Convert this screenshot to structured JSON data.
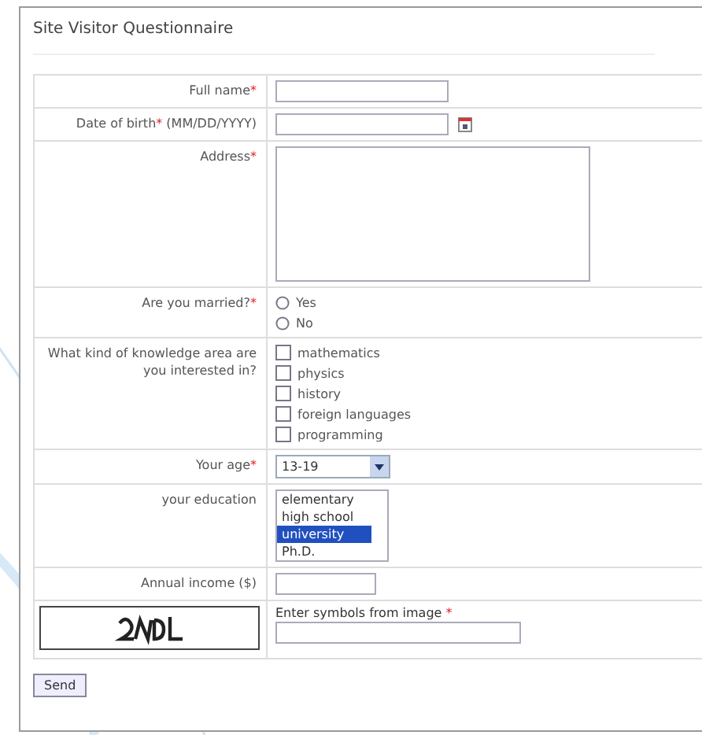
{
  "title": "Site Visitor Questionnaire",
  "fields": [
    {
      "kind": "text",
      "label": "Full name",
      "mark": "*"
    },
    {
      "kind": "date",
      "label": "Date of birth",
      "mark": "*",
      "hint": "(MM/DD/YYYY)"
    },
    {
      "kind": "textarea",
      "label": "Address",
      "mark": "*"
    },
    {
      "kind": "radio",
      "label": "Are you married?",
      "mark": "*",
      "options": [
        {
          "label": "Yes",
          "selected": false
        },
        {
          "label": "No",
          "selected": false
        }
      ]
    },
    {
      "kind": "checkboxes",
      "label": "What kind of knowledge area are you interested in?",
      "options": [
        {
          "label": "mathematics",
          "checked": false
        },
        {
          "label": "physics",
          "checked": false
        },
        {
          "label": "history",
          "checked": false
        },
        {
          "label": "foreign languages",
          "checked": false
        },
        {
          "label": "programming",
          "checked": false
        }
      ]
    },
    {
      "kind": "select",
      "label": "Your age",
      "mark": "*",
      "value": "13-19"
    },
    {
      "kind": "listbox",
      "label": "your education",
      "options": [
        {
          "label": "elementary",
          "selected": false
        },
        {
          "label": "high school",
          "selected": false
        },
        {
          "label": "university",
          "selected": true
        },
        {
          "label": "Ph.D.",
          "selected": false
        }
      ]
    },
    {
      "kind": "small",
      "label": "Annual income ($)"
    }
  ],
  "captcha": {
    "prompt": "Enter symbols from image",
    "mark": "*"
  },
  "submit": "Send"
}
